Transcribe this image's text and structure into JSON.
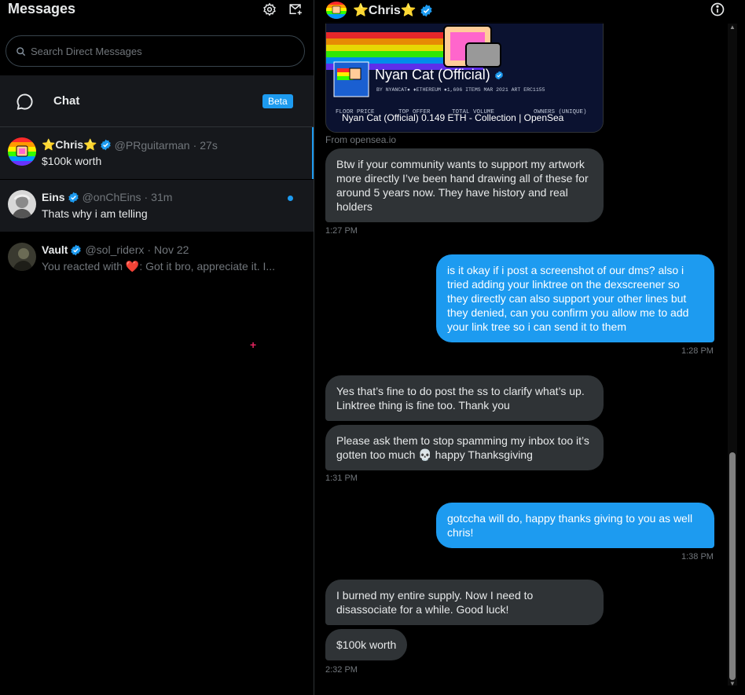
{
  "left": {
    "title": "Messages",
    "search_placeholder": "Search Direct Messages",
    "chat_label": "Chat",
    "beta_badge": "Beta",
    "conversations": [
      {
        "name": "⭐Chris⭐",
        "handle": "@PRguitarman",
        "time": "27s",
        "message": "$100k worth",
        "unread": false
      },
      {
        "name": "Eins",
        "handle": "@onChEins",
        "time": "31m",
        "message": "Thats why i am telling",
        "unread": true
      },
      {
        "name": "Vault",
        "handle": "@sol_riderx",
        "time": "Nov 22",
        "message": "You reacted with ❤️: Got it bro, appreciate it. I...",
        "unread": false
      }
    ],
    "separator": "·"
  },
  "right": {
    "header_name": "⭐Chris⭐",
    "card": {
      "nft_title": "Nyan Cat (Official)",
      "nft_meta": "BY NYANCAT●  ♦ETHEREUM  ●1,606 ITEMS  MAR 2021  ART  ERC1155",
      "stats_labels": [
        "FLOOR PRICE",
        "TOP OFFER",
        "TOTAL VOLUME",
        "OWNERS (UNIQUE)"
      ],
      "caption": "Nyan Cat (Official) 0.149 ETH - Collection | OpenSea",
      "source": "From opensea.io"
    },
    "messages": [
      {
        "dir": "in",
        "text": "Btw if your community wants to support my artwork more directly I’ve been hand drawing all of these for around 5 years now. They have history and real holders"
      },
      {
        "time": "1:27 PM"
      },
      {
        "dir": "out",
        "text": "is it okay if i post a screenshot of our dms? also i tried adding your linktree on the dexscreener so they directly can also support your other lines but they denied, can you confirm you allow me to add your link tree so i can send it to them"
      },
      {
        "time": "1:28 PM"
      },
      {
        "dir": "in",
        "text": "Yes that’s fine to do post the ss to clarify what’s up. Linktree thing is fine too. Thank you"
      },
      {
        "dir": "in",
        "text": "Please ask them to stop spamming my inbox too it’s gotten too much 💀 happy Thanksgiving"
      },
      {
        "time": "1:31 PM"
      },
      {
        "dir": "out",
        "text": "gotccha will do, happy thanks giving to you as well chris!"
      },
      {
        "time": "1:38 PM"
      },
      {
        "dir": "in",
        "text": "I burned my entire supply. Now I need to disassociate for a while. Good luck!"
      },
      {
        "dir": "in",
        "text": "$100k worth"
      },
      {
        "time": "2:32 PM"
      }
    ]
  },
  "colors": {
    "accent": "#1d9bf0",
    "incoming_bubble": "#2f3336",
    "muted": "#71767b",
    "background": "#000000"
  },
  "icons": [
    "settings-gear-icon",
    "new-message-icon",
    "search-icon",
    "chat-bubble-icon",
    "verified-badge-icon",
    "info-icon"
  ]
}
